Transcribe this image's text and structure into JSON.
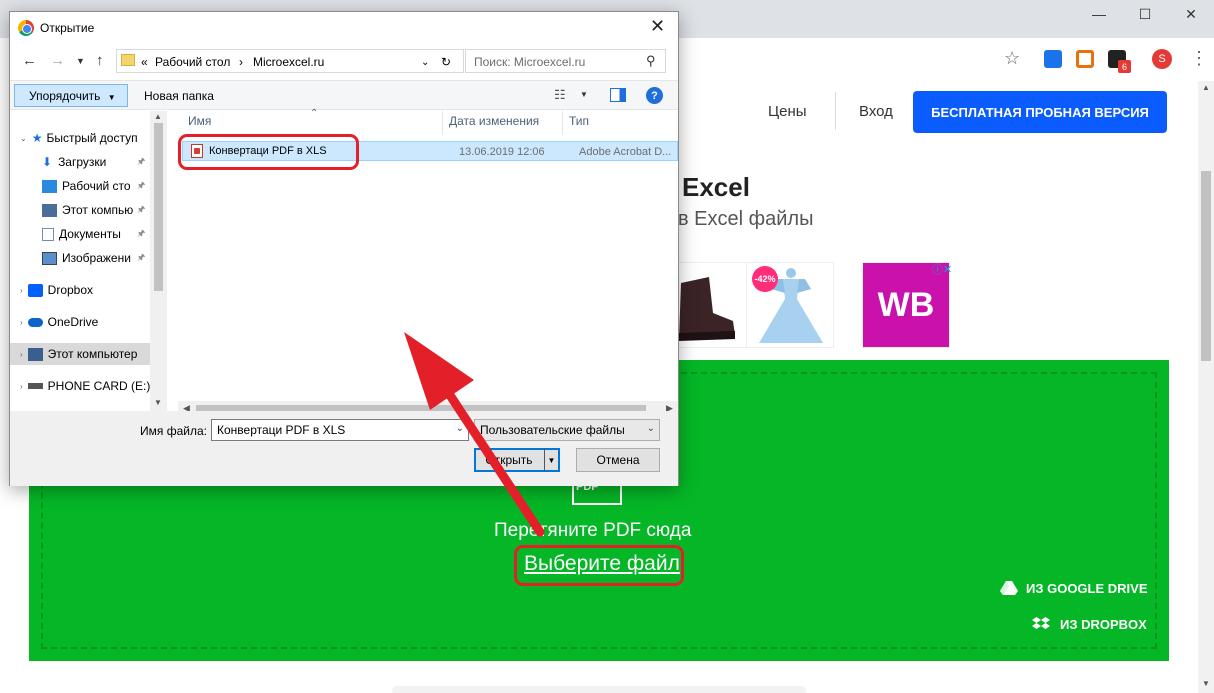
{
  "browser": {
    "avatar_letter": "S",
    "ext_badge": "6",
    "accent": "#0a5cff"
  },
  "site": {
    "nav_prices": "Цены",
    "nav_login": "Вход",
    "trial_button": "БЕСПЛАТНАЯ ПРОБНАЯ ВЕРСИЯ",
    "hero_title": "Excel",
    "hero_subtitle": "в Excel файлы",
    "ad_badge": "-42%",
    "ad_wb": "WB",
    "pdf_icon_label": "PDF",
    "drop_text": "Перетяните PDF сюда",
    "choose_file": "Выберите файл",
    "google_drive": "ИЗ GOOGLE DRIVE",
    "dropbox": "ИЗ DROPBOX",
    "dropzone_color": "#05b726"
  },
  "dialog": {
    "title": "Открытие",
    "breadcrumb_prefix": "«",
    "breadcrumb": [
      "Рабочий стол",
      "Microexcel.ru"
    ],
    "search_placeholder": "Поиск: Microexcel.ru",
    "organize": "Упорядочить",
    "new_folder": "Новая папка",
    "nav_items": [
      {
        "label": "Быстрый доступ",
        "icon": "star-icon"
      },
      {
        "label": "Загрузки",
        "icon": "download-icon"
      },
      {
        "label": "Рабочий сто",
        "icon": "desktop-icon"
      },
      {
        "label": "Этот компью",
        "icon": "computer-icon"
      },
      {
        "label": "Документы",
        "icon": "document-icon"
      },
      {
        "label": "Изображени",
        "icon": "pictures-icon"
      },
      {
        "label": "Dropbox",
        "icon": "dropbox-icon"
      },
      {
        "label": "OneDrive",
        "icon": "onedrive-icon"
      },
      {
        "label": "Этот компьютер",
        "icon": "computer-icon"
      },
      {
        "label": "PHONE CARD (E:)",
        "icon": "drive-icon"
      }
    ],
    "columns": {
      "name": "Имя",
      "date": "Дата изменения",
      "type": "Тип"
    },
    "file": {
      "name": "Конвертаци PDF в XLS",
      "date": "13.06.2019 12:06",
      "type": "Adobe Acrobat D..."
    },
    "filename_label": "Имя файла:",
    "filename_value": "Конвертаци PDF в XLS",
    "filetype_value": "Пользовательские файлы",
    "open_button": "Открыть",
    "cancel_button": "Отмена"
  }
}
